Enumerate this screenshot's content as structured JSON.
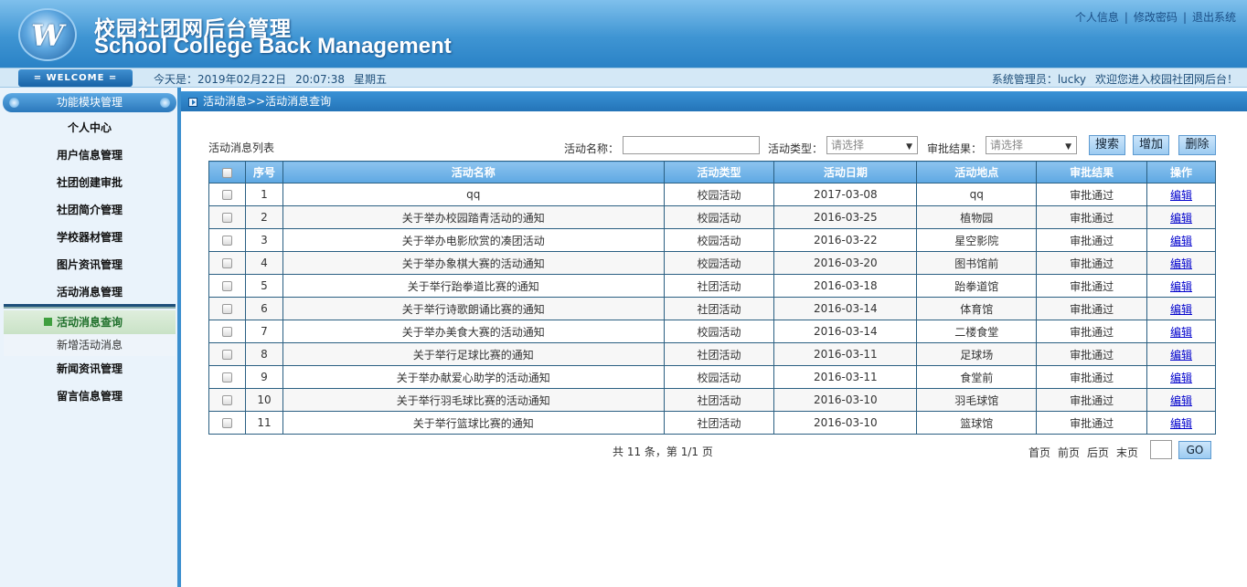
{
  "header": {
    "logo_letter": "W",
    "title_cn": "校园社团网后台管理",
    "title_en": "School College Back Management",
    "links": [
      "个人信息",
      "修改密码",
      "退出系统"
    ]
  },
  "infobar": {
    "welcome": "= WELCOME =",
    "today_label": "今天是：2019年02月22日",
    "time": "20:07:38",
    "weekday": "星期五",
    "admin": "系统管理员：lucky",
    "greeting": "欢迎您进入校园社团网后台！"
  },
  "sidebar": {
    "header": "功能模块管理",
    "items": [
      "个人中心",
      "用户信息管理",
      "社团创建审批",
      "社团简介管理",
      "学校器材管理",
      "图片资讯管理",
      "活动消息管理"
    ],
    "active_item": "活动消息查询",
    "sub_item": "新增活动消息",
    "items_after": [
      "新闻资讯管理",
      "留言信息管理"
    ]
  },
  "content": {
    "breadcrumb": "活动消息>>活动消息查询",
    "list_title": "活动消息列表",
    "filters": {
      "name_label": "活动名称：",
      "type_label": "活动类型：",
      "type_value": "请选择",
      "result_label": "审批结果：",
      "result_value": "请选择"
    },
    "buttons": {
      "search": "搜索",
      "add": "增加",
      "delete": "删除"
    },
    "columns": [
      "序号",
      "活动名称",
      "活动类型",
      "活动日期",
      "活动地点",
      "审批结果",
      "操作"
    ],
    "rows": [
      {
        "no": "1",
        "name": "qq",
        "type": "校园活动",
        "date": "2017-03-08",
        "place": "qq",
        "result": "审批通过",
        "op": "编辑"
      },
      {
        "no": "2",
        "name": "关于举办校园踏青活动的通知",
        "type": "校园活动",
        "date": "2016-03-25",
        "place": "植物园",
        "result": "审批通过",
        "op": "编辑"
      },
      {
        "no": "3",
        "name": "关于举办电影欣赏的凑团活动",
        "type": "校园活动",
        "date": "2016-03-22",
        "place": "星空影院",
        "result": "审批通过",
        "op": "编辑"
      },
      {
        "no": "4",
        "name": "关于举办象棋大赛的活动通知",
        "type": "校园活动",
        "date": "2016-03-20",
        "place": "图书馆前",
        "result": "审批通过",
        "op": "编辑"
      },
      {
        "no": "5",
        "name": "关于举行跆拳道比赛的通知",
        "type": "社团活动",
        "date": "2016-03-18",
        "place": "跆拳道馆",
        "result": "审批通过",
        "op": "编辑"
      },
      {
        "no": "6",
        "name": "关于举行诗歌朗诵比赛的通知",
        "type": "社团活动",
        "date": "2016-03-14",
        "place": "体育馆",
        "result": "审批通过",
        "op": "编辑"
      },
      {
        "no": "7",
        "name": "关于举办美食大赛的活动通知",
        "type": "校园活动",
        "date": "2016-03-14",
        "place": "二楼食堂",
        "result": "审批通过",
        "op": "编辑"
      },
      {
        "no": "8",
        "name": "关于举行足球比赛的通知",
        "type": "社团活动",
        "date": "2016-03-11",
        "place": "足球场",
        "result": "审批通过",
        "op": "编辑"
      },
      {
        "no": "9",
        "name": "关于举办献爱心助学的活动通知",
        "type": "校园活动",
        "date": "2016-03-11",
        "place": "食堂前",
        "result": "审批通过",
        "op": "编辑"
      },
      {
        "no": "10",
        "name": "关于举行羽毛球比赛的活动通知",
        "type": "社团活动",
        "date": "2016-03-10",
        "place": "羽毛球馆",
        "result": "审批通过",
        "op": "编辑"
      },
      {
        "no": "11",
        "name": "关于举行篮球比赛的通知",
        "type": "社团活动",
        "date": "2016-03-10",
        "place": "篮球馆",
        "result": "审批通过",
        "op": "编辑"
      }
    ],
    "pager": {
      "summary": "共 11 条，第 1/1 页",
      "first": "首页",
      "prev": "前页",
      "next": "后页",
      "last": "末页",
      "go": "GO"
    }
  }
}
